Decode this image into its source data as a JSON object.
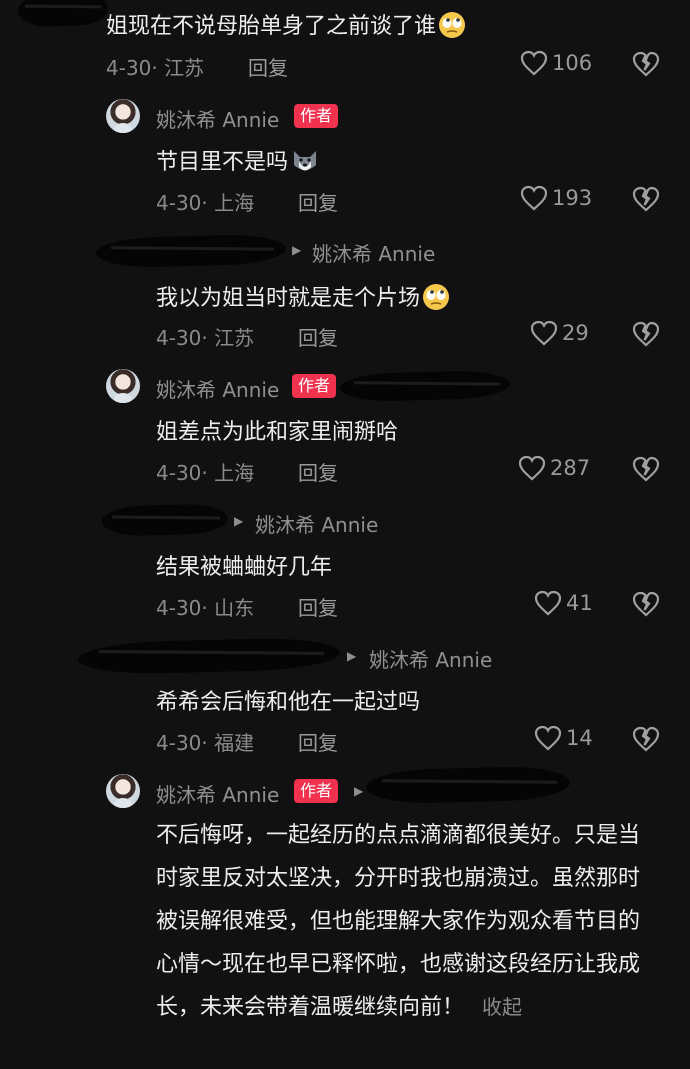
{
  "comments": [
    {
      "text": "姐现在不说母胎单身了之前谈了谁",
      "date": "4-30",
      "location": "江苏",
      "reply_label": "回复",
      "likes": "106",
      "emoji": "face-with-rolling-eyes"
    },
    {
      "author": "姚沐希 Annie",
      "badge": "作者",
      "text": "节目里不是吗",
      "date": "4-30",
      "location": "上海",
      "reply_label": "回复",
      "likes": "193",
      "emoji": "husky-dog"
    },
    {
      "reply_to": "姚沐希 Annie",
      "text": "我以为姐当时就是走个片场",
      "date": "4-30",
      "location": "江苏",
      "reply_label": "回复",
      "likes": "29",
      "emoji": "face-with-rolling-eyes"
    },
    {
      "author": "姚沐希 Annie",
      "badge": "作者",
      "text": "姐差点为此和家里闹掰哈",
      "date": "4-30",
      "location": "上海",
      "reply_label": "回复",
      "likes": "287"
    },
    {
      "reply_to": "姚沐希 Annie",
      "text": "结果被蛐蛐好几年",
      "date": "4-30",
      "location": "山东",
      "reply_label": "回复",
      "likes": "41"
    },
    {
      "reply_to": "姚沐希 Annie",
      "text": "希希会后悔和他在一起过吗",
      "date": "4-30",
      "location": "福建",
      "reply_label": "回复",
      "likes": "14"
    },
    {
      "author": "姚沐希 Annie",
      "badge": "作者",
      "text": "不后悔呀，一起经历的点点滴滴都很美好。只是当时家里反对太坚决，分开时我也崩溃过。虽然那时被误解很难受，但也能理解大家作为观众看节目的心情～现在也早已释怀啦，也感谢这段经历让我成长，未来会带着温暖继续向前！",
      "collapse_label": "收起"
    }
  ],
  "icons": {
    "like": "heart-outline-icon",
    "dislike": "broken-heart-icon",
    "reply_arrow": "triangle-right-icon"
  },
  "colors": {
    "background": "#111111",
    "author_badge": "#f0324f",
    "secondary_text": "#8f8f8f"
  }
}
